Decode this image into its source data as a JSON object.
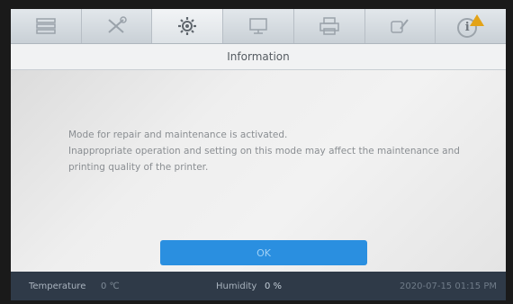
{
  "tabs": [
    {
      "icon": "stack-icon"
    },
    {
      "icon": "tools-icon"
    },
    {
      "icon": "settings-gear-icon"
    },
    {
      "icon": "monitor-icon"
    },
    {
      "icon": "printer-icon"
    },
    {
      "icon": "maintenance-icon"
    },
    {
      "icon": "info-icon"
    }
  ],
  "dialog": {
    "title": "Information",
    "line1": "Mode for repair and maintenance is activated.",
    "line2": "Inappropriate operation and setting on this mode may affect the maintenance and",
    "line3": "printing quality of the printer.",
    "ok_label": "OK"
  },
  "status": {
    "temperature_label": "Temperature",
    "temperature_value": "0 ℃",
    "humidity_label": "Humidity",
    "humidity_value": "0 %",
    "datetime": "2020-07-15 01:15 PM"
  },
  "colors": {
    "accent": "#2a8fe0",
    "warning": "#e3a318",
    "statusbar": "#2f3a48"
  }
}
